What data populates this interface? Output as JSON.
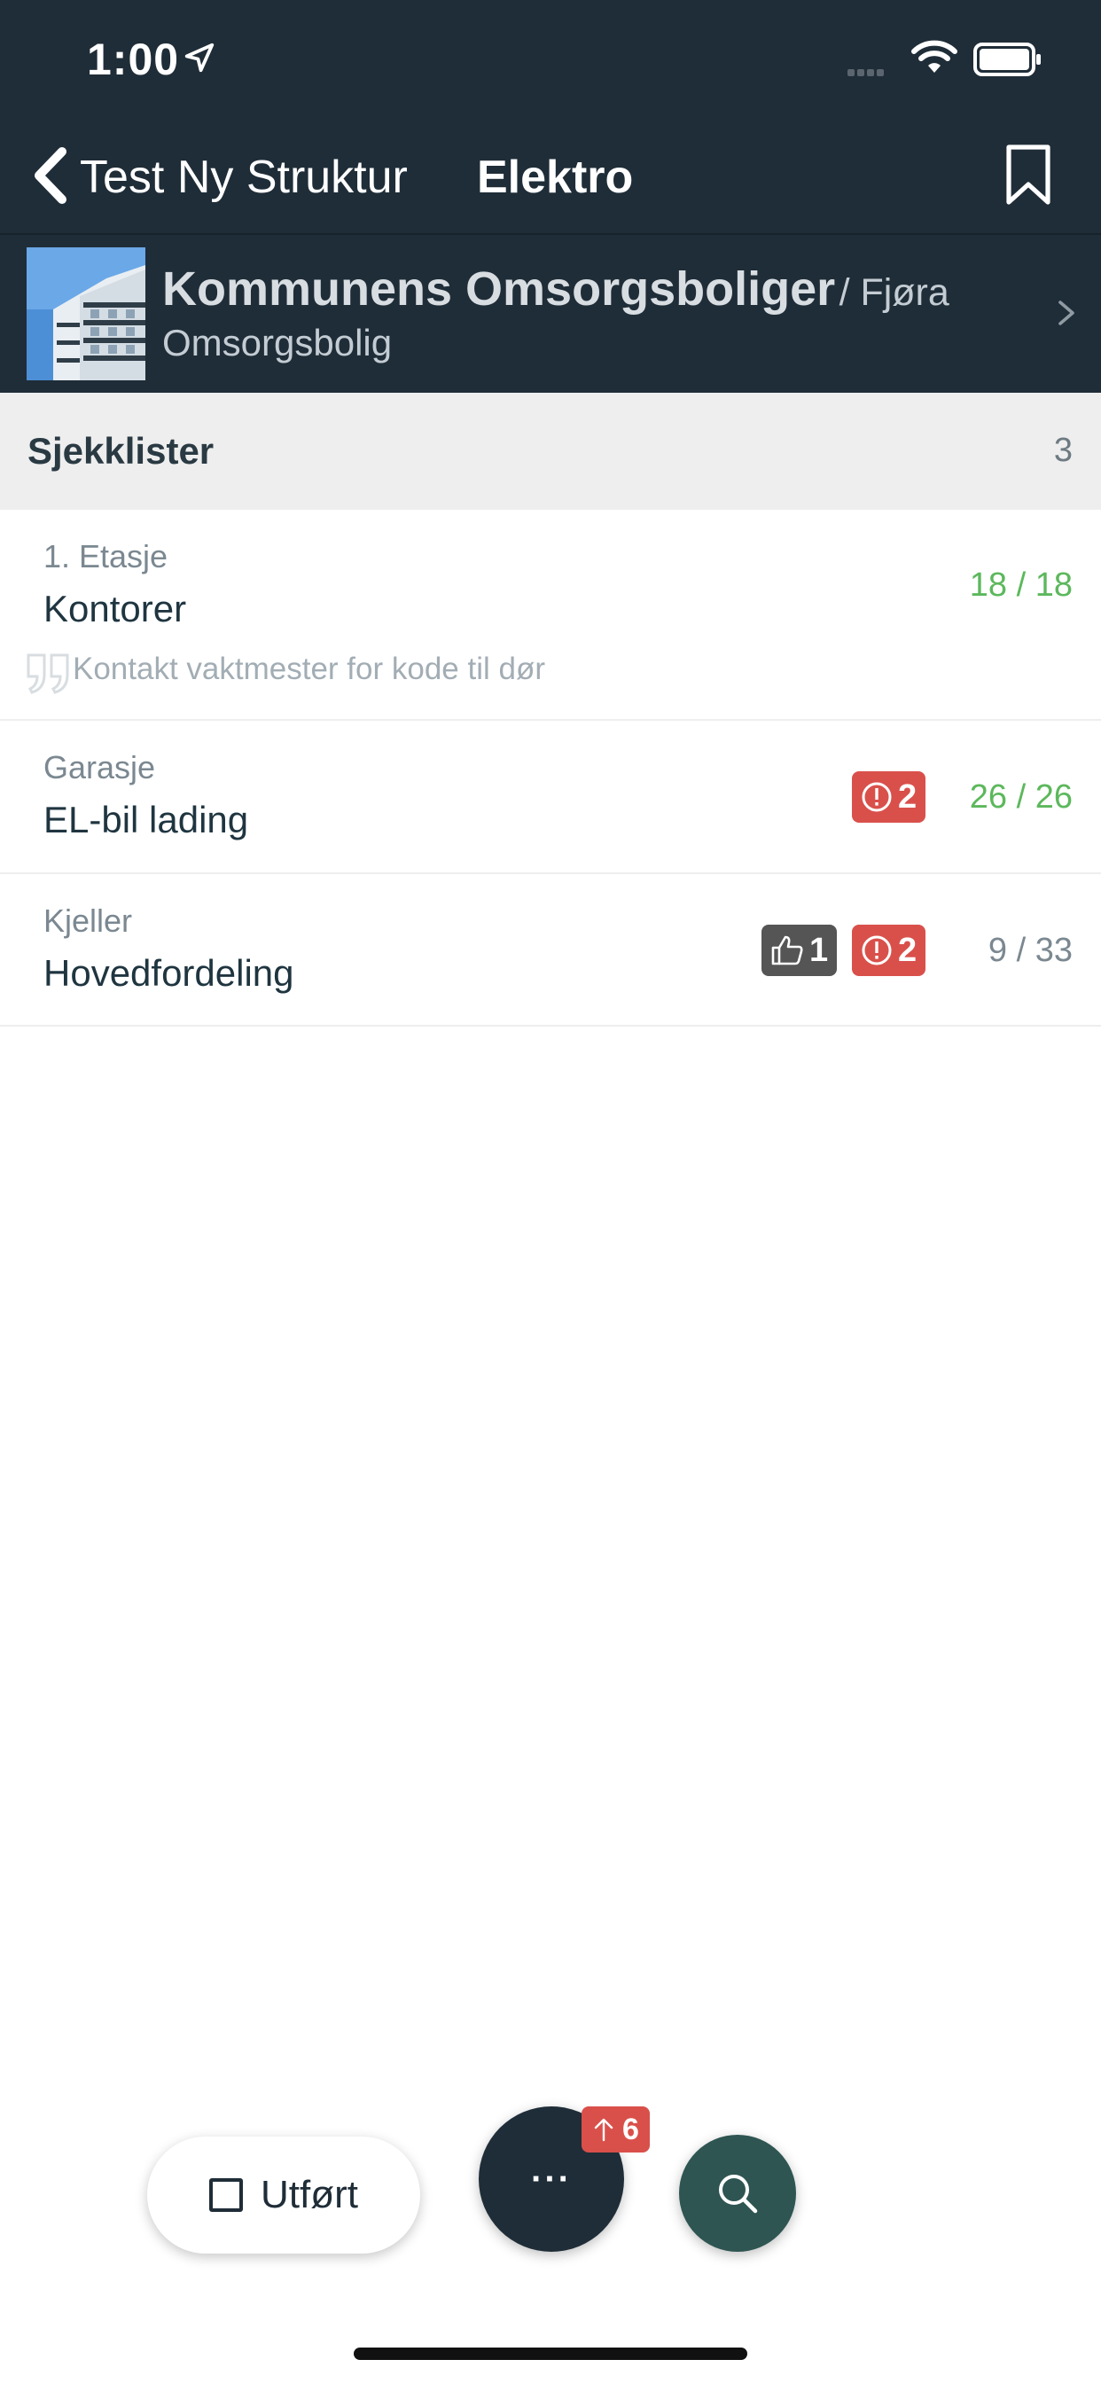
{
  "status_bar": {
    "time": "1:00"
  },
  "nav": {
    "back_label": "Test Ny Struktur",
    "title": "Elektro"
  },
  "project": {
    "name": "Kommunens Omsorgsboliger",
    "separator_sub": "/ Fjøra",
    "subtitle": "Omsorgsbolig"
  },
  "section": {
    "title": "Sjekklister",
    "count": "3"
  },
  "checklists": [
    {
      "location": "1. Etasje",
      "title": "Kontorer",
      "note": "Kontakt vaktmester for kode til dør",
      "progress": "18 / 18",
      "progress_color": "#5cb85c"
    },
    {
      "location": "Garasje",
      "title": "EL-bil lading",
      "issues": "2",
      "progress": "26 / 26",
      "progress_color": "#5cb85c"
    },
    {
      "location": "Kjeller",
      "title": "Hovedfordeling",
      "likes": "1",
      "issues": "2",
      "progress": "9 / 33",
      "progress_color": "#7b8891"
    }
  ],
  "actions": {
    "done_label": "Utført",
    "more_label": "···",
    "upload_count": "6"
  },
  "colors": {
    "header_bg": "#1f2d38",
    "badge_red": "#d9504b",
    "badge_dark": "#555555",
    "search_btn": "#2e5552",
    "progress_green": "#5cb85c"
  }
}
